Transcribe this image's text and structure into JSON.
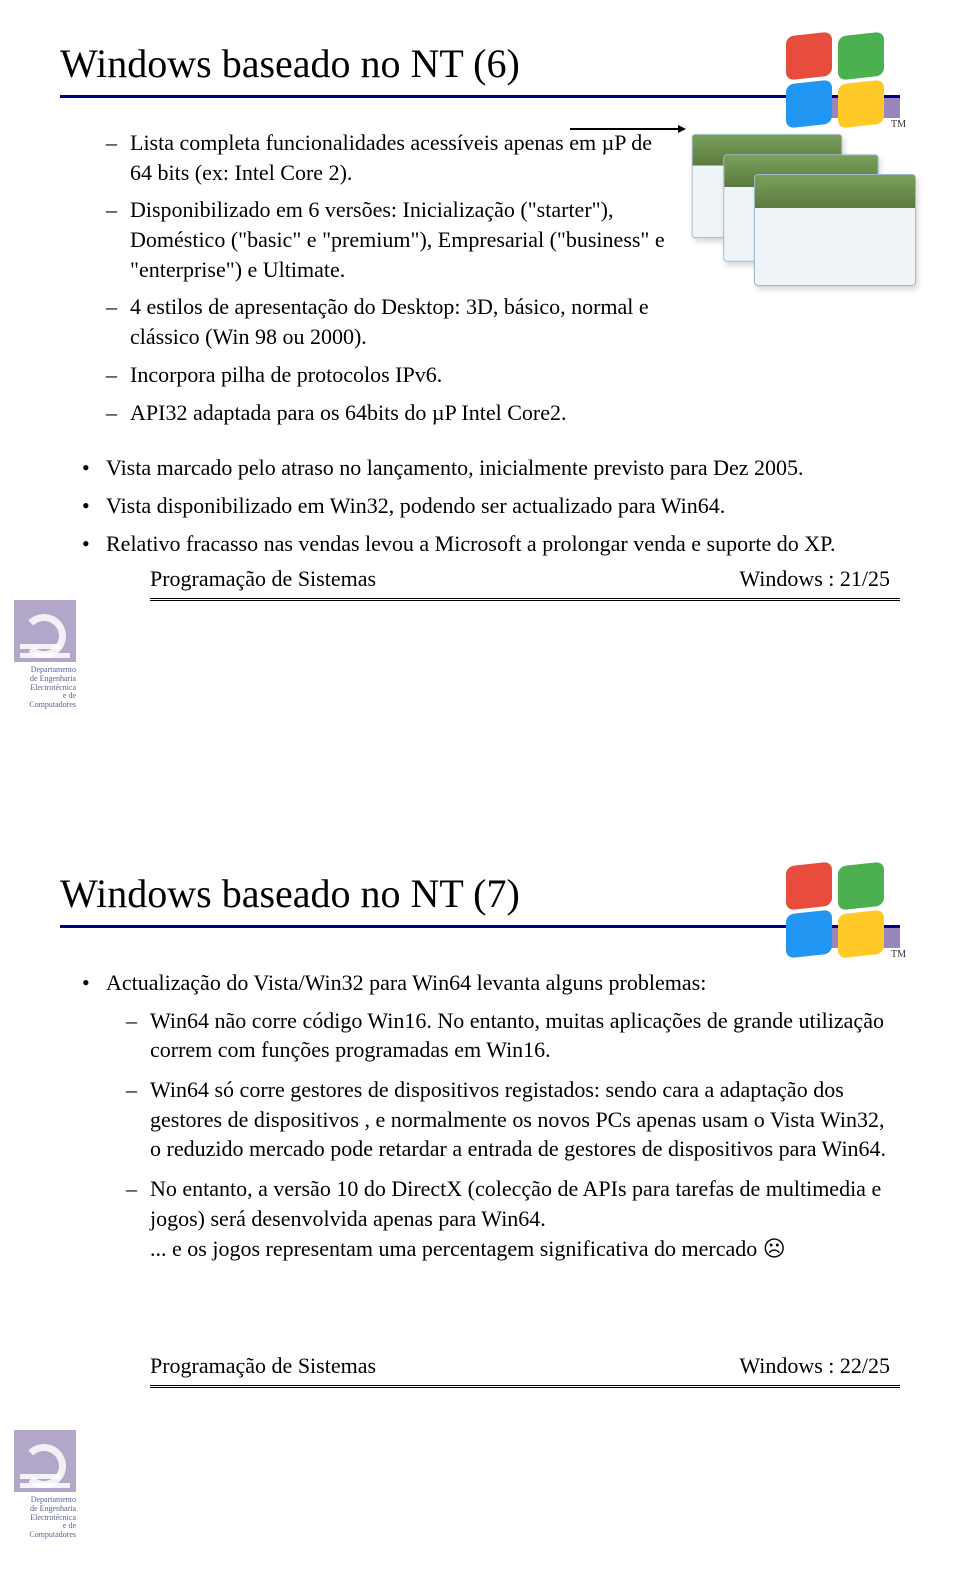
{
  "badge": {
    "line1": "Departamento",
    "line2": "de Engenharia",
    "line3": "Electrotécnica",
    "line4": "e de",
    "line5": "Computadores"
  },
  "slide1": {
    "title": "Windows baseado no NT (6)",
    "dash": [
      "Lista completa funcionalidades acessíveis apenas em µP de 64 bits (ex: Intel Core 2).",
      "Disponibilizado em 6 versões: Inicialização (\"starter\"), Doméstico (\"basic\" e \"premium\"), Empresarial (\"business\" e \"enterprise\") e Ultimate.",
      "4 estilos de apresentação do Desktop: 3D, básico, normal e clássico (Win 98 ou 2000).",
      "Incorpora pilha de protocolos IPv6.",
      "API32 adaptada para os 64bits do µP Intel Core2."
    ],
    "bullets": [
      "Vista marcado pelo atraso no lançamento, inicialmente previsto para Dez 2005.",
      "Vista disponibilizado em Win32, podendo ser actualizado para Win64.",
      "Relativo fracasso nas vendas levou a Microsoft a prolongar venda e suporte do XP."
    ],
    "footer_left": "Programação de Sistemas",
    "footer_right": "Windows : 21/25"
  },
  "slide2": {
    "title": "Windows baseado no NT (7)",
    "intro": "Actualização do Vista/Win32 para Win64 levanta alguns problemas:",
    "dash": [
      "Win64 não corre código Win16. No entanto, muitas aplicações de grande utilização correm com funções programadas em Win16.",
      "Win64 só corre gestores de dispositivos registados: sendo cara a adaptação dos gestores de dispositivos , e normalmente os novos PCs apenas usam o Vista Win32, o reduzido mercado pode retardar a entrada de gestores de dispositivos  para Win64.",
      "No entanto, a versão 10 do DirectX (colecção de APIs para tarefas de multimedia e jogos) será desenvolvida apenas para Win64.\n... e os jogos representam uma percentagem significativa do mercado ☹"
    ],
    "footer_left": "Programação de Sistemas",
    "footer_right": "Windows : 22/25"
  }
}
